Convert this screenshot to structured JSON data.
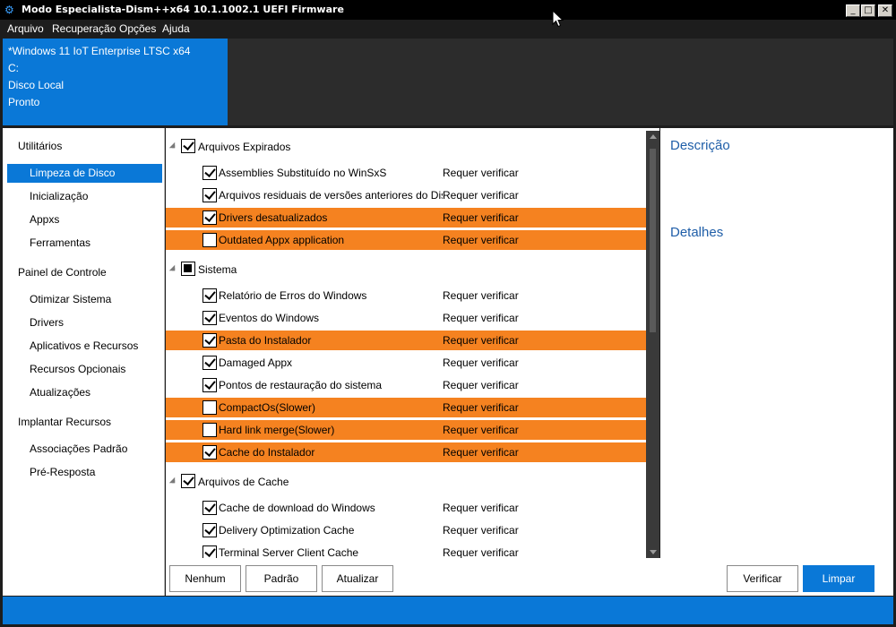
{
  "window": {
    "title": "Modo Especialista-Dism++x64 10.1.1002.1 UEFI Firmware",
    "controls": {
      "minimize": "_",
      "maximize": "□",
      "close": "✕"
    }
  },
  "menu": [
    "Arquivo",
    "Recuperação",
    "Opções",
    "Ajuda"
  ],
  "header": {
    "os": "*Windows 11 IoT Enterprise LTSC x64",
    "drive": "C:",
    "disk": "Disco Local",
    "status": "Pronto"
  },
  "sidebar": {
    "groups": [
      {
        "label": "Utilitários",
        "items": [
          "Limpeza de Disco",
          "Inicialização",
          "Appxs",
          "Ferramentas"
        ]
      },
      {
        "label": "Painel de Controle",
        "items": [
          "Otimizar Sistema",
          "Drivers",
          "Aplicativos e Recursos",
          "Recursos Opcionais",
          "Atualizações"
        ]
      },
      {
        "label": "Implantar Recursos",
        "items": [
          "Associações Padrão",
          "Pré-Resposta"
        ]
      }
    ],
    "selected": "Limpeza de Disco"
  },
  "cleanup": {
    "groups": [
      {
        "label": "Arquivos Expirados",
        "state": "checked",
        "items": [
          {
            "label": "Assemblies Substituído no WinSxS",
            "status": "Requer verificar",
            "checked": true,
            "highlight": false
          },
          {
            "label": "Arquivos residuais de versões anteriores do Disn",
            "status": "Requer verificar",
            "checked": true,
            "highlight": false
          },
          {
            "label": "Drivers desatualizados",
            "status": "Requer verificar",
            "checked": true,
            "highlight": true
          },
          {
            "label": "Outdated Appx application",
            "status": "Requer verificar",
            "checked": false,
            "highlight": true
          }
        ]
      },
      {
        "label": "Sistema",
        "state": "partial",
        "items": [
          {
            "label": "Relatório de Erros do Windows",
            "status": "Requer verificar",
            "checked": true,
            "highlight": false
          },
          {
            "label": "Eventos do Windows",
            "status": "Requer verificar",
            "checked": true,
            "highlight": false
          },
          {
            "label": "Pasta do Instalador",
            "status": "Requer verificar",
            "checked": true,
            "highlight": true
          },
          {
            "label": "Damaged Appx",
            "status": "Requer verificar",
            "checked": true,
            "highlight": false
          },
          {
            "label": "Pontos de restauração do sistema",
            "status": "Requer verificar",
            "checked": true,
            "highlight": false
          },
          {
            "label": "CompactOs(Slower)",
            "status": "Requer verificar",
            "checked": false,
            "highlight": true
          },
          {
            "label": "Hard link merge(Slower)",
            "status": "Requer verificar",
            "checked": false,
            "highlight": true
          },
          {
            "label": "Cache do Instalador",
            "status": "Requer verificar",
            "checked": true,
            "highlight": true
          }
        ]
      },
      {
        "label": "Arquivos de Cache",
        "state": "checked",
        "items": [
          {
            "label": "Cache de download do Windows",
            "status": "Requer verificar",
            "checked": true,
            "highlight": false
          },
          {
            "label": "Delivery Optimization Cache",
            "status": "Requer verificar",
            "checked": true,
            "highlight": false
          },
          {
            "label": "Terminal Server Client Cache",
            "status": "Requer verificar",
            "checked": true,
            "highlight": false
          }
        ]
      }
    ]
  },
  "details_panel": {
    "description_title": "Descrição",
    "details_title": "Detalhes"
  },
  "buttons": {
    "none": "Nenhum",
    "default": "Padrão",
    "refresh": "Atualizar",
    "verify": "Verificar",
    "clean": "Limpar"
  },
  "colors": {
    "accent": "#0a78d7",
    "highlight": "#f58220",
    "title_blue": "#1f5ea8"
  }
}
